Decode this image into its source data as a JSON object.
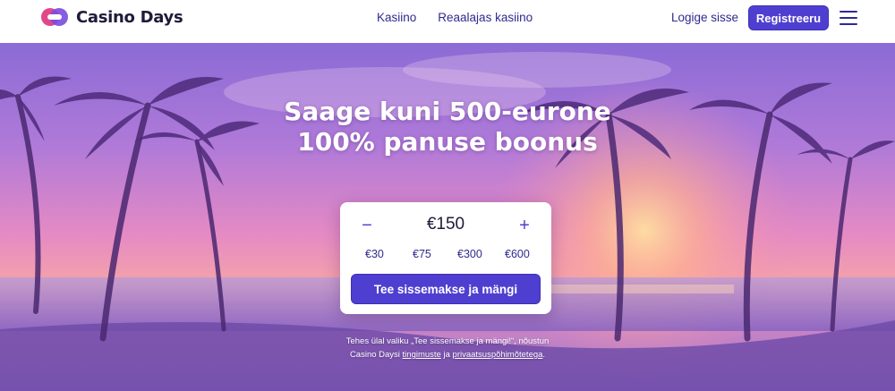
{
  "brand": {
    "name": "Casino Days",
    "accent": "#4f3fd0",
    "logo_colors": [
      "#e0488a",
      "#7a4ae0"
    ]
  },
  "nav": {
    "items": [
      {
        "label": "Kasiino"
      },
      {
        "label": "Reaalajas kasiino"
      }
    ]
  },
  "header": {
    "login_label": "Logige sisse",
    "register_label": "Registreeru",
    "menu_icon": "hamburger-icon"
  },
  "hero": {
    "headline_line1": "Saage kuni 500-eurone",
    "headline_line2": "100% panuse boonus"
  },
  "deposit": {
    "amount": "€150",
    "minus_icon": "minus-icon",
    "plus_icon": "plus-icon",
    "presets": [
      "€30",
      "€75",
      "€300",
      "€600"
    ],
    "cta_label": "Tee sissemakse ja mängi"
  },
  "terms": {
    "text_before": "Tehes ülal valiku „Tee sissemakse ja mängi!“, nõustun",
    "text_mid": "Casino Daysi",
    "link_terms": "tingimuste",
    "text_and": "ja",
    "link_privacy": "privaatsuspõhimõtetega",
    "text_end": "."
  }
}
